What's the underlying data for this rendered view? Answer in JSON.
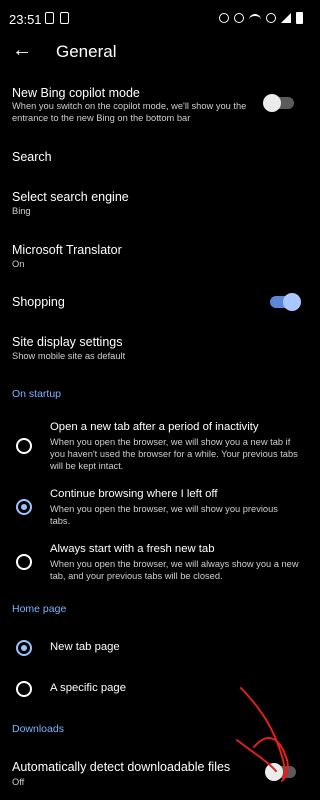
{
  "status_bar": {
    "time": "23:51"
  },
  "header": {
    "title": "General"
  },
  "items": {
    "bing_copilot": {
      "title": "New Bing copilot mode",
      "subtitle": "When you switch on the copilot mode, we'll show you the entrance to the new Bing on the bottom bar",
      "enabled": false
    },
    "search": {
      "title": "Search"
    },
    "search_engine": {
      "title": "Select search engine",
      "value": "Bing"
    },
    "translator": {
      "title": "Microsoft Translator",
      "value": "On"
    },
    "shopping": {
      "title": "Shopping",
      "enabled": true
    },
    "site_display": {
      "title": "Site display settings",
      "value": "Show mobile site as default"
    }
  },
  "startup": {
    "header": "On startup",
    "options": [
      {
        "title": "Open a new tab after a period of inactivity",
        "desc": "When you open the browser, we will show you a new tab if you haven't used the browser for a while. Your previous tabs will be kept intact.",
        "selected": false
      },
      {
        "title": "Continue browsing where I left off",
        "desc": "When you open the browser, we will show you previous tabs.",
        "selected": true
      },
      {
        "title": "Always start with a fresh new tab",
        "desc": "When you open the browser, we will always show you a new tab, and your previous tabs will be closed.",
        "selected": false
      }
    ]
  },
  "homepage": {
    "header": "Home page",
    "options": [
      {
        "title": "New tab page",
        "selected": true
      },
      {
        "title": "A specific page",
        "selected": false
      }
    ]
  },
  "downloads": {
    "header": "Downloads",
    "auto_detect": {
      "title": "Automatically detect downloadable files",
      "value": "Off",
      "enabled": false
    }
  },
  "colors": {
    "accent": "#7ab3ff",
    "background": "#000000",
    "annotation": "#e0201c"
  }
}
